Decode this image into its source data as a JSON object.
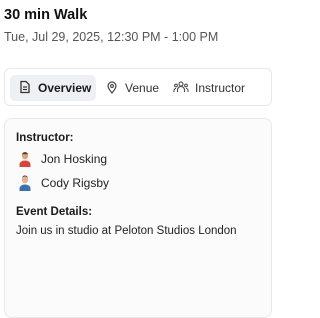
{
  "event": {
    "title": "30 min Walk",
    "datetime": "Tue, Jul 29, 2025, 12:30 PM - 1:00 PM"
  },
  "tabs": [
    {
      "label": "Overview",
      "icon": "document-icon",
      "active": true
    },
    {
      "label": "Venue",
      "icon": "location-pin-icon",
      "active": false
    },
    {
      "label": "Instructor",
      "icon": "people-icon",
      "active": false
    }
  ],
  "details": {
    "instructor_heading": "Instructor:",
    "instructors": [
      {
        "name": "Jon Hosking",
        "icon": "avatar-red-shirt-icon"
      },
      {
        "name": "Cody Rigsby",
        "icon": "avatar-blue-shirt-icon"
      }
    ],
    "event_details_heading": "Event Details:",
    "event_details_text": "Join us in studio at Peloton Studios London"
  },
  "colors": {
    "panel_bg": "#fbfbfc",
    "active_tab_bg": "#eef0f3",
    "border": "#e8e8ea"
  }
}
